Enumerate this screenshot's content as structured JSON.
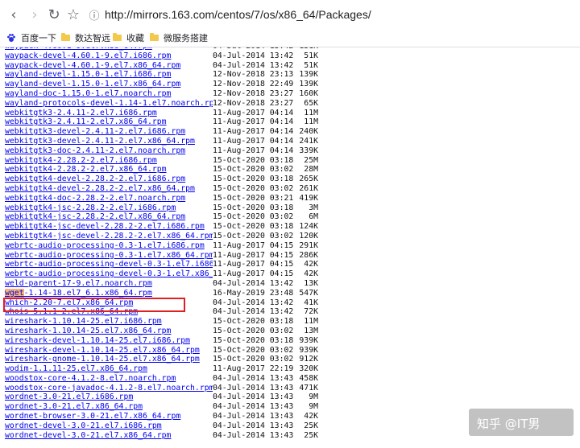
{
  "browser": {
    "url": "http://mirrors.163.com/centos/7/os/x86_64/Packages/",
    "bookmarks": [
      "百度一下",
      "数达智远",
      "收藏",
      "微服务搭建"
    ]
  },
  "listing": {
    "rows": [
      {
        "name": "waypack-4.60.1-9.el7.x86_64.rpm",
        "date": "04-Jul-2014 13:42",
        "size": "131K"
      },
      {
        "name": "waypack-devel-4.60.1-9.el7.i686.rpm",
        "date": "04-Jul-2014 13:42",
        "size": "51K"
      },
      {
        "name": "waypack-devel-4.60.1-9.el7.x86_64.rpm",
        "date": "04-Jul-2014 13:42",
        "size": "51K"
      },
      {
        "name": "wayland-devel-1.15.0-1.el7.i686.rpm",
        "date": "12-Nov-2018 23:13",
        "size": "139K"
      },
      {
        "name": "wayland-devel-1.15.0-1.el7.x86_64.rpm",
        "date": "12-Nov-2018 22:49",
        "size": "139K"
      },
      {
        "name": "wayland-doc-1.15.0-1.el7.noarch.rpm",
        "date": "12-Nov-2018 23:27",
        "size": "160K"
      },
      {
        "name": "wayland-protocols-devel-1.14-1.el7.noarch.rpm",
        "date": "12-Nov-2018 23:27",
        "size": "65K"
      },
      {
        "name": "webkitgtk3-2.4.11-2.el7.i686.rpm",
        "date": "11-Aug-2017 04:14",
        "size": "11M"
      },
      {
        "name": "webkitgtk3-2.4.11-2.el7.x86_64.rpm",
        "date": "11-Aug-2017 04:14",
        "size": "11M"
      },
      {
        "name": "webkitgtk3-devel-2.4.11-2.el7.i686.rpm",
        "date": "11-Aug-2017 04:14",
        "size": "240K"
      },
      {
        "name": "webkitgtk3-devel-2.4.11-2.el7.x86_64.rpm",
        "date": "11-Aug-2017 04:14",
        "size": "241K"
      },
      {
        "name": "webkitgtk3-doc-2.4.11-2.el7.noarch.rpm",
        "date": "11-Aug-2017 04:14",
        "size": "339K"
      },
      {
        "name": "webkitgtk4-2.28.2-2.el7.i686.rpm",
        "date": "15-Oct-2020 03:18",
        "size": "25M"
      },
      {
        "name": "webkitgtk4-2.28.2-2.el7.x86_64.rpm",
        "date": "15-Oct-2020 03:02",
        "size": "28M"
      },
      {
        "name": "webkitgtk4-devel-2.28.2-2.el7.i686.rpm",
        "date": "15-Oct-2020 03:18",
        "size": "265K"
      },
      {
        "name": "webkitgtk4-devel-2.28.2-2.el7.x86_64.rpm",
        "date": "15-Oct-2020 03:02",
        "size": "261K"
      },
      {
        "name": "webkitgtk4-doc-2.28.2-2.el7.noarch.rpm",
        "date": "15-Oct-2020 03:21",
        "size": "419K"
      },
      {
        "name": "webkitgtk4-jsc-2.28.2-2.el7.i686.rpm",
        "date": "15-Oct-2020 03:18",
        "size": "3M"
      },
      {
        "name": "webkitgtk4-jsc-2.28.2-2.el7.x86_64.rpm",
        "date": "15-Oct-2020 03:02",
        "size": "6M"
      },
      {
        "name": "webkitgtk4-jsc-devel-2.28.2-2.el7.i686.rpm",
        "date": "15-Oct-2020 03:18",
        "size": "124K"
      },
      {
        "name": "webkitgtk4-jsc-devel-2.28.2-2.el7.x86_64.rpm",
        "date": "15-Oct-2020 03:02",
        "size": "120K"
      },
      {
        "name": "webrtc-audio-processing-0.3-1.el7.i686.rpm",
        "date": "11-Aug-2017 04:15",
        "size": "291K"
      },
      {
        "name": "webrtc-audio-processing-0.3-1.el7.x86_64.rpm",
        "date": "11-Aug-2017 04:15",
        "size": "286K"
      },
      {
        "name": "webrtc-audio-processing-devel-0.3-1.el7.i686.rpm",
        "date": "11-Aug-2017 04:15",
        "size": "42K"
      },
      {
        "name": "webrtc-audio-processing-devel-0.3-1.el7.x86_64.rpm",
        "date": "11-Aug-2017 04:15",
        "size": "42K"
      },
      {
        "name": "weld-parent-17-9.el7.noarch.rpm",
        "date": "04-Jul-2014 13:42",
        "size": "13K"
      },
      {
        "name": "wget-1.14-18.el7_6.1.x86_64.rpm",
        "date": "16-May-2019 23:48",
        "size": "547K",
        "highlight": "wget"
      },
      {
        "name": "which-2.20-7.el7.x86_64.rpm",
        "date": "04-Jul-2014 13:42",
        "size": "41K"
      },
      {
        "name": "whois-5.1.1-2.el7.x86_64.rpm",
        "date": "04-Jul-2014 13:42",
        "size": "72K"
      },
      {
        "name": "wireshark-1.10.14-25.el7.i686.rpm",
        "date": "15-Oct-2020 03:18",
        "size": "11M"
      },
      {
        "name": "wireshark-1.10.14-25.el7.x86_64.rpm",
        "date": "15-Oct-2020 03:02",
        "size": "13M"
      },
      {
        "name": "wireshark-devel-1.10.14-25.el7.i686.rpm",
        "date": "15-Oct-2020 03:18",
        "size": "939K"
      },
      {
        "name": "wireshark-devel-1.10.14-25.el7.x86_64.rpm",
        "date": "15-Oct-2020 03:02",
        "size": "939K"
      },
      {
        "name": "wireshark-gnome-1.10.14-25.el7.x86_64.rpm",
        "date": "15-Oct-2020 03:02",
        "size": "912K"
      },
      {
        "name": "wodim-1.1.11-25.el7.x86_64.rpm",
        "date": "11-Aug-2017 22:19",
        "size": "320K"
      },
      {
        "name": "woodstox-core-4.1.2-8.el7.noarch.rpm",
        "date": "04-Jul-2014 13:43",
        "size": "458K"
      },
      {
        "name": "woodstox-core-javadoc-4.1.2-8.el7.noarch.rpm",
        "date": "04-Jul-2014 13:43",
        "size": "471K"
      },
      {
        "name": "wordnet-3.0-21.el7.i686.rpm",
        "date": "04-Jul-2014 13:43",
        "size": "9M"
      },
      {
        "name": "wordnet-3.0-21.el7.x86_64.rpm",
        "date": "04-Jul-2014 13:43",
        "size": "9M"
      },
      {
        "name": "wordnet-browser-3.0-21.el7.x86_64.rpm",
        "date": "04-Jul-2014 13:43",
        "size": "42K"
      },
      {
        "name": "wordnet-devel-3.0-21.el7.i686.rpm",
        "date": "04-Jul-2014 13:43",
        "size": "25K"
      },
      {
        "name": "wordnet-devel-3.0-21.el7.x86_64.rpm",
        "date": "04-Jul-2014 13:43",
        "size": "25K"
      }
    ]
  },
  "watermark": "知乎 @IT男",
  "colors": {
    "link": "#0000ee",
    "highlight": "#f5b37a",
    "box": "#e02020"
  }
}
